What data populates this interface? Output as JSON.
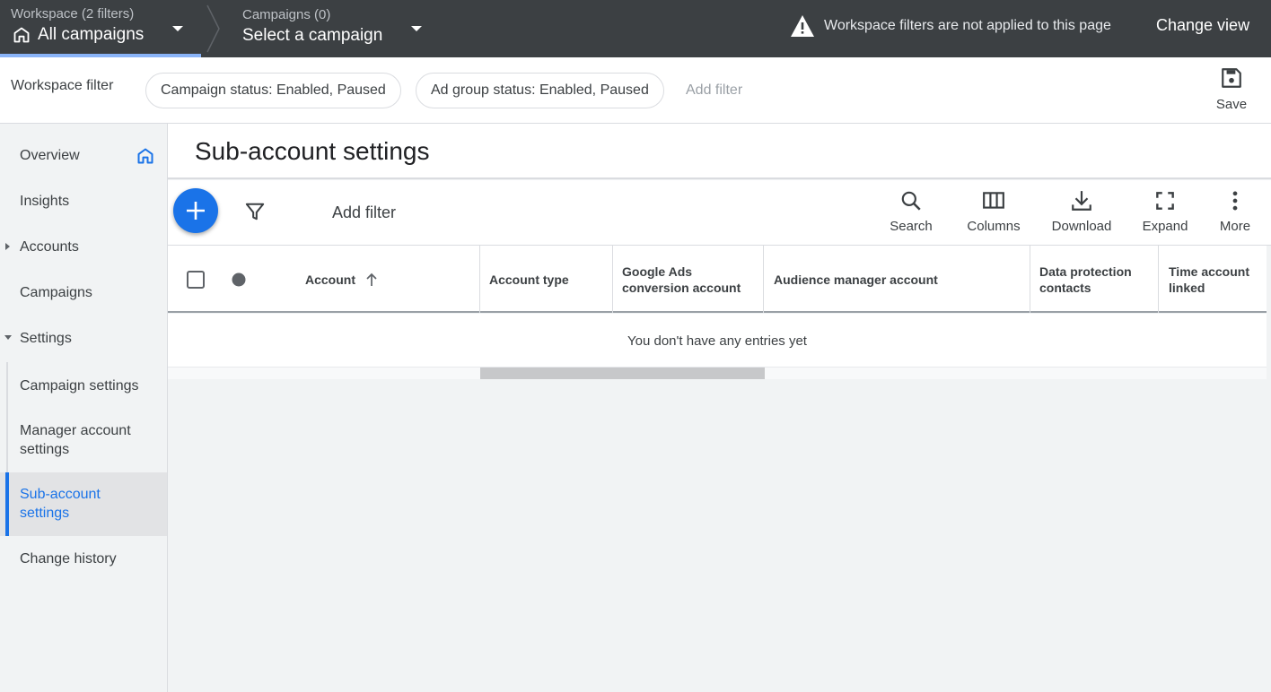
{
  "topbar": {
    "workspace_sub": "Workspace (2 filters)",
    "workspace_main": "All campaigns",
    "campaigns_sub": "Campaigns (0)",
    "campaigns_main": "Select a campaign",
    "warning": "Workspace filters are not applied to this page",
    "change_view": "Change view"
  },
  "filterbar": {
    "label": "Workspace filter",
    "chips": [
      "Campaign status: Enabled, Paused",
      "Ad group status: Enabled, Paused"
    ],
    "add_filter": "Add filter",
    "save": "Save"
  },
  "sidebar": {
    "items": [
      {
        "label": "Overview"
      },
      {
        "label": "Insights"
      },
      {
        "label": "Accounts"
      },
      {
        "label": "Campaigns"
      },
      {
        "label": "Settings"
      },
      {
        "label": "Campaign settings"
      },
      {
        "label": "Manager account settings"
      },
      {
        "label": "Sub-account settings"
      },
      {
        "label": "Change history"
      }
    ]
  },
  "main": {
    "title": "Sub-account settings",
    "add_filter": "Add filter",
    "tools": [
      "Search",
      "Columns",
      "Download",
      "Expand",
      "More"
    ],
    "columns": [
      "Account",
      "Account type",
      "Google Ads conversion account",
      "Audience manager account",
      "Data protection contacts",
      "Time account linked"
    ],
    "empty_message": "You don't have any entries yet"
  },
  "colors": {
    "accent": "#1a73e8",
    "topbar": "#3c4043"
  }
}
